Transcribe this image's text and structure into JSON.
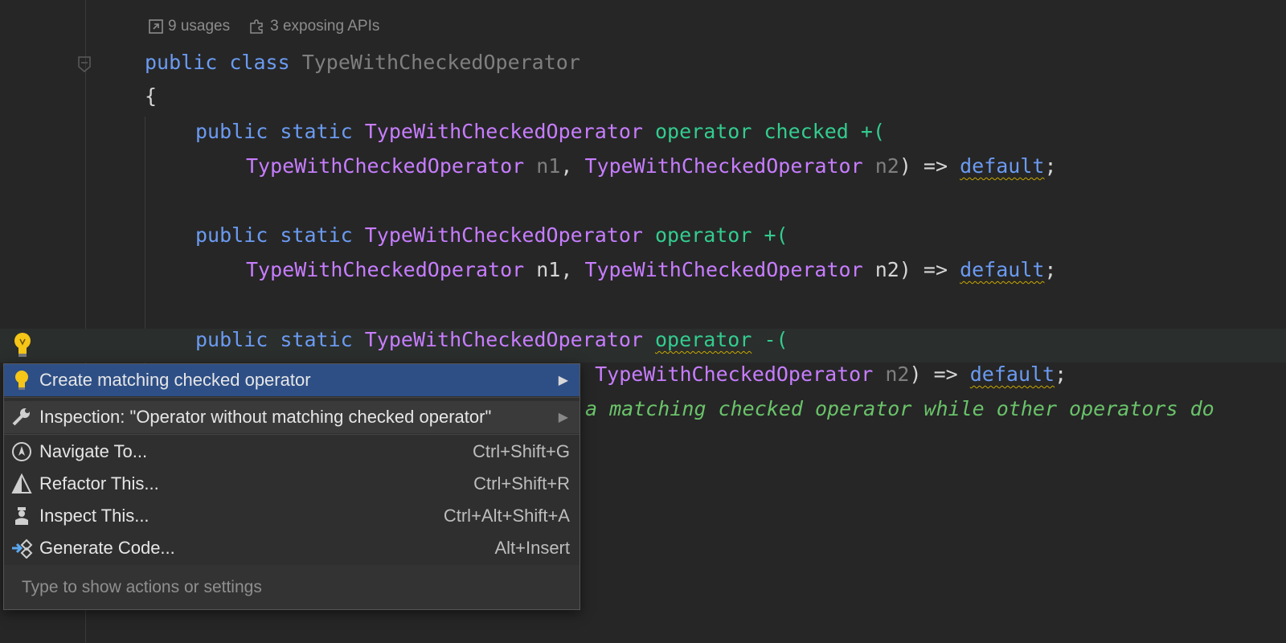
{
  "hints": {
    "usages": "9 usages",
    "apis": "3 exposing APIs"
  },
  "code": {
    "l1": [
      "public",
      "class",
      "TypeWithCheckedOperator"
    ],
    "l2": "{",
    "l3": [
      "public",
      "static",
      "TypeWithCheckedOperator",
      "operator",
      "checked",
      "+("
    ],
    "l4": [
      "TypeWithCheckedOperator",
      "n1",
      ", ",
      "TypeWithCheckedOperator",
      "n2",
      ") => ",
      "default",
      ";"
    ],
    "l5": [
      "public",
      "static",
      "TypeWithCheckedOperator",
      "operator",
      "+("
    ],
    "l6": [
      "TypeWithCheckedOperator",
      " n1, ",
      "TypeWithCheckedOperator",
      " n2) => ",
      "default",
      ";"
    ],
    "l7": [
      "public",
      "static",
      "TypeWithCheckedOperator",
      "operator",
      "-("
    ],
    "l8": [
      ", ",
      "TypeWithCheckedOperator",
      "n2",
      ") => ",
      "default",
      ";"
    ],
    "l9": "a matching checked operator while other operators do"
  },
  "menu": {
    "items": [
      {
        "label": "Create matching checked operator",
        "shortcut": "",
        "icon": "lightbulb-icon"
      },
      {
        "label": "Inspection: \"Operator without matching checked operator\"",
        "shortcut": "",
        "icon": "wrench-icon"
      },
      {
        "label": "Navigate To...",
        "shortcut": "Ctrl+Shift+G",
        "icon": "navigate-icon"
      },
      {
        "label": "Refactor This...",
        "shortcut": "Ctrl+Shift+R",
        "icon": "refactor-icon"
      },
      {
        "label": "Inspect This...",
        "shortcut": "Ctrl+Alt+Shift+A",
        "icon": "inspect-icon"
      },
      {
        "label": "Generate Code...",
        "shortcut": "Alt+Insert",
        "icon": "generate-icon"
      }
    ],
    "search_placeholder": "Type to show actions or settings"
  },
  "colors": {
    "selection": "#2e4f86",
    "keyword": "#6b9bf2",
    "type": "#c77dff",
    "operator": "#33cc8f"
  }
}
